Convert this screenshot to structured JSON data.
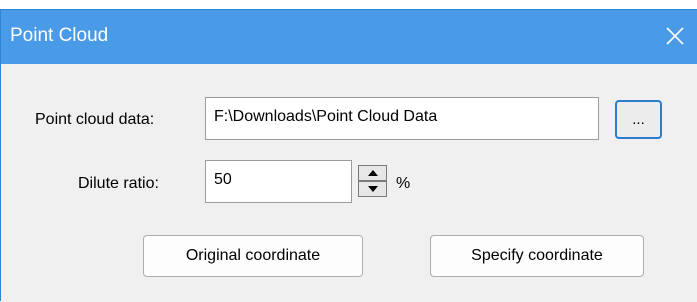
{
  "window": {
    "title": "Point Cloud"
  },
  "point_cloud_data": {
    "label": "Point cloud data:",
    "value": "F:\\Downloads\\Point Cloud Data",
    "browse_label": "..."
  },
  "dilute_ratio": {
    "label": "Dilute ratio:",
    "value": "50",
    "unit": "%"
  },
  "buttons": {
    "original_coordinate": "Original coordinate",
    "specify_coordinate": "Specify coordinate"
  },
  "colors": {
    "titlebar": "#4a9be7",
    "client_background": "#f0f0f0",
    "focus_border": "#2b7bd0"
  },
  "icons": {
    "close": "close-icon",
    "spin_up": "triangle-up-icon",
    "spin_down": "triangle-down-icon"
  }
}
